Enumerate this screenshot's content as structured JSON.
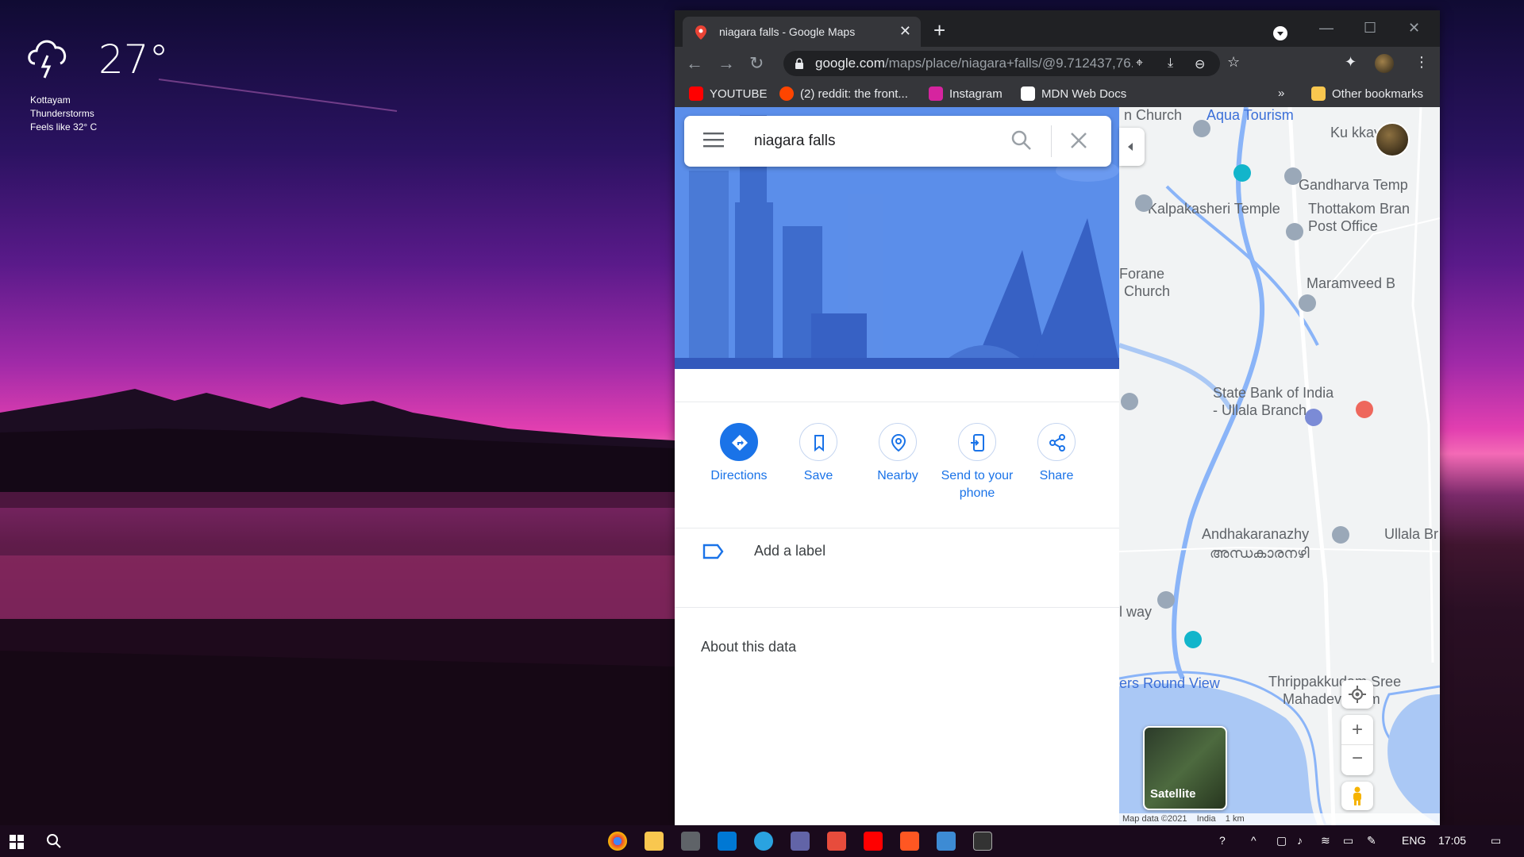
{
  "desktop": {
    "weather": {
      "temperature": "27°",
      "location": "Kottayam",
      "condition": "Thunderstorms",
      "feels_like": "Feels like 32° C",
      "icon": "thunderstorm-icon"
    }
  },
  "browser": {
    "tab_title": "niagara falls - Google Maps",
    "url_main": "google.com",
    "url_rest": "/maps/place/niagara+falls/@9.712437,76.39397...",
    "bookmarks": [
      {
        "label": "YOUTUBE",
        "color": "#ff0000"
      },
      {
        "label": "(2) reddit: the front...",
        "color": "#ff4500"
      },
      {
        "label": "Instagram",
        "color": "#d6249f"
      },
      {
        "label": "MDN Web Docs",
        "color": "#ffffff"
      }
    ],
    "bookmarks_overflow": "»",
    "other_bookmarks": "Other bookmarks"
  },
  "maps": {
    "search_query": "niagara falls",
    "actions": [
      {
        "label": "Directions",
        "icon": "directions-icon"
      },
      {
        "label": "Save",
        "icon": "bookmark-icon"
      },
      {
        "label": "Nearby",
        "icon": "nearby-icon"
      },
      {
        "label": "Send to your phone",
        "icon": "send-to-phone-icon"
      },
      {
        "label": "Share",
        "icon": "share-icon"
      }
    ],
    "add_label": "Add a label",
    "about_data": "About this data",
    "map_labels": {
      "aqua_tourism": "Aqua Tourism",
      "church_top": "n Church",
      "gandharva": "Gandharva Temp",
      "kalpakasheri": "Kalpakasheri Temple",
      "thottakom": "Thottakom Bran",
      "post_office": "Post Office",
      "forane": "Forane",
      "church": "Church",
      "maramveed": "Maramveed B",
      "state_bank": "State Bank of India",
      "ullala_branch": "- Ullala Branch",
      "andhakaranazhy": "Andhakaranazhy",
      "andhakaranazhy_ml": "അന്ധകാരനഴി",
      "ullala_br": "Ullala Br",
      "way": "l way",
      "round_view": "ers Round View",
      "thrippakkudam": "Thrippakkudam Sree",
      "mahadeva": "Mahadeva Tem",
      "kuttikkav": "Ku    kkav"
    },
    "satellite_label": "Satellite",
    "map_footer": "Map data ©2021    India    1 km"
  },
  "taskbar": {
    "language": "ENG",
    "time": "17:05"
  }
}
